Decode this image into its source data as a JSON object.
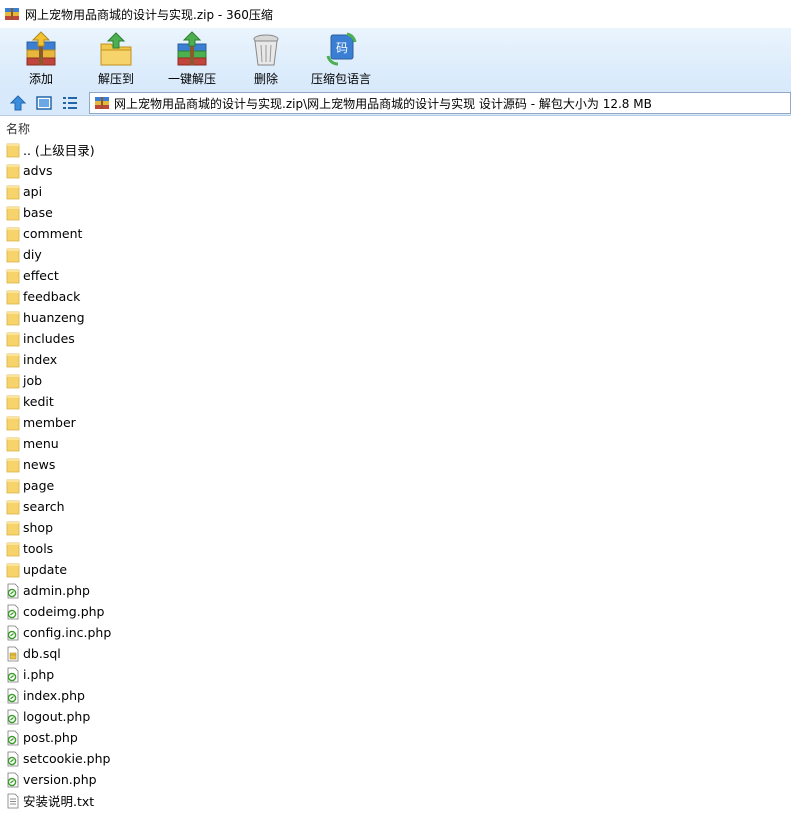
{
  "window": {
    "title": "网上宠物用品商城的设计与实现.zip - 360压缩"
  },
  "toolbar": {
    "buttons": [
      {
        "label": "添加",
        "icon": "add-archive-icon"
      },
      {
        "label": "解压到",
        "icon": "extract-to-icon"
      },
      {
        "label": "一键解压",
        "icon": "one-click-extract-icon"
      },
      {
        "label": "删除",
        "icon": "delete-icon"
      },
      {
        "label": "压缩包语言",
        "icon": "archive-language-icon"
      }
    ]
  },
  "address": {
    "path": "网上宠物用品商城的设计与实现.zip\\网上宠物用品商城的设计与实现 设计源码 - 解包大小为 12.8 MB"
  },
  "list": {
    "column_name": "名称",
    "items": [
      {
        "name": ".. (上级目录)",
        "type": "folder"
      },
      {
        "name": "advs",
        "type": "folder"
      },
      {
        "name": "api",
        "type": "folder"
      },
      {
        "name": "base",
        "type": "folder"
      },
      {
        "name": "comment",
        "type": "folder"
      },
      {
        "name": "diy",
        "type": "folder"
      },
      {
        "name": "effect",
        "type": "folder"
      },
      {
        "name": "feedback",
        "type": "folder"
      },
      {
        "name": "huanzeng",
        "type": "folder"
      },
      {
        "name": "includes",
        "type": "folder"
      },
      {
        "name": "index",
        "type": "folder"
      },
      {
        "name": "job",
        "type": "folder"
      },
      {
        "name": "kedit",
        "type": "folder"
      },
      {
        "name": "member",
        "type": "folder"
      },
      {
        "name": "menu",
        "type": "folder"
      },
      {
        "name": "news",
        "type": "folder"
      },
      {
        "name": "page",
        "type": "folder"
      },
      {
        "name": "search",
        "type": "folder"
      },
      {
        "name": "shop",
        "type": "folder"
      },
      {
        "name": "tools",
        "type": "folder"
      },
      {
        "name": "update",
        "type": "folder"
      },
      {
        "name": "admin.php",
        "type": "php"
      },
      {
        "name": "codeimg.php",
        "type": "php"
      },
      {
        "name": "config.inc.php",
        "type": "php"
      },
      {
        "name": "db.sql",
        "type": "sql"
      },
      {
        "name": "i.php",
        "type": "php"
      },
      {
        "name": "index.php",
        "type": "php"
      },
      {
        "name": "logout.php",
        "type": "php"
      },
      {
        "name": "post.php",
        "type": "php"
      },
      {
        "name": "setcookie.php",
        "type": "php"
      },
      {
        "name": "version.php",
        "type": "php"
      },
      {
        "name": "安装说明.txt",
        "type": "txt"
      }
    ]
  },
  "colors": {
    "toolbar_top": "#eaf4fd",
    "toolbar_bottom": "#d7e9fb",
    "folder": "#f7d46b",
    "php_accent": "#3a9a2a"
  }
}
